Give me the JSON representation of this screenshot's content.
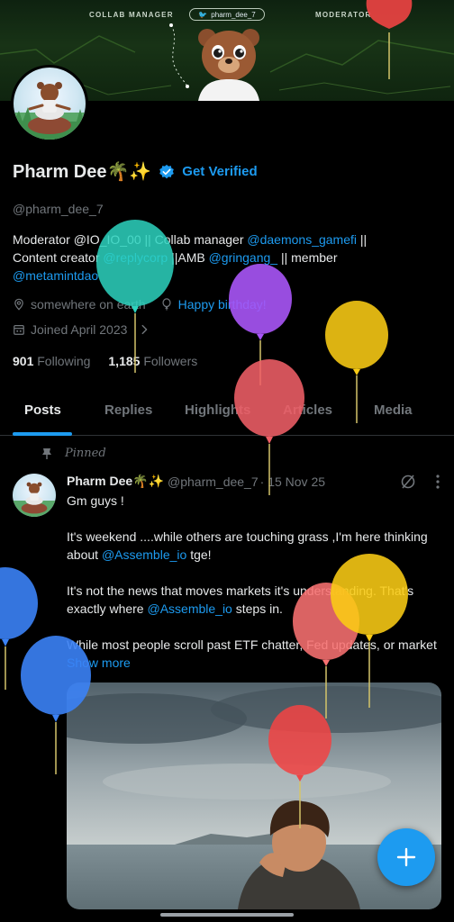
{
  "banner": {
    "left_label": "COLLAB MANAGER",
    "handle": "pharm_dee_7",
    "right_label": "MODERATOR"
  },
  "profile": {
    "display_name": "Pharm Dee🌴✨",
    "get_verified": "Get Verified",
    "handle": "@pharm_dee_7",
    "bio": {
      "t1": "Moderator @IO_IO_00 || Collab manager ",
      "m1": "@daemons_gamefi",
      "t2": " ||",
      "t3": "Content creator ",
      "m2": "@replycorp",
      "t4": " ||AMB ",
      "m3": "@gringang_",
      "t5": " || member",
      "m4": "@metamintdao"
    },
    "location": "somewhere on earth",
    "birthday": "Happy birthday!",
    "joined": "Joined April 2023",
    "following_count": "901",
    "following_label": "Following",
    "followers_count": "1,185",
    "followers_label": "Followers"
  },
  "tabs": [
    {
      "label": "Posts",
      "active": true
    },
    {
      "label": "Replies"
    },
    {
      "label": "Highlights"
    },
    {
      "label": "Articles"
    },
    {
      "label": "Media"
    }
  ],
  "post": {
    "pinned_label": "Pinned",
    "author": "Pharm Dee🌴✨",
    "handle": "@pharm_dee_7",
    "time": "· 15 Nov 25",
    "p1": "Gm guys !",
    "p2_text": "It's weekend ....while others are touching grass ,I'm here thinking about ",
    "p2_mention": "@Assemble_io",
    "p2_end": " tge!",
    "p3_text": "It's not the news that moves markets it's understanding. That's exactly where ",
    "p3_mention": "@Assemble_io",
    "p3_end": " steps in.",
    "p4_text": "While most people scroll past ETF chatter, Fed updates, or market ",
    "show_more": "Show more"
  },
  "colors": {
    "accent": "#1d9bf0",
    "muted": "#71767b",
    "text": "#e7e9ea",
    "background": "#000000"
  },
  "icons": {
    "verified": "verified-badge-icon",
    "location": "location-pin-icon",
    "birthday": "balloon-icon",
    "calendar": "calendar-icon",
    "chevron": "chevron-right-icon",
    "pin": "pin-icon",
    "grok": "grok-icon",
    "more": "more-vertical-icon",
    "compose": "plus-icon"
  },
  "balloons": {
    "colors": [
      "#ef4444",
      "#2dd4bf",
      "#a855f7",
      "#facc15",
      "#3b82f6",
      "#f87171"
    ]
  }
}
